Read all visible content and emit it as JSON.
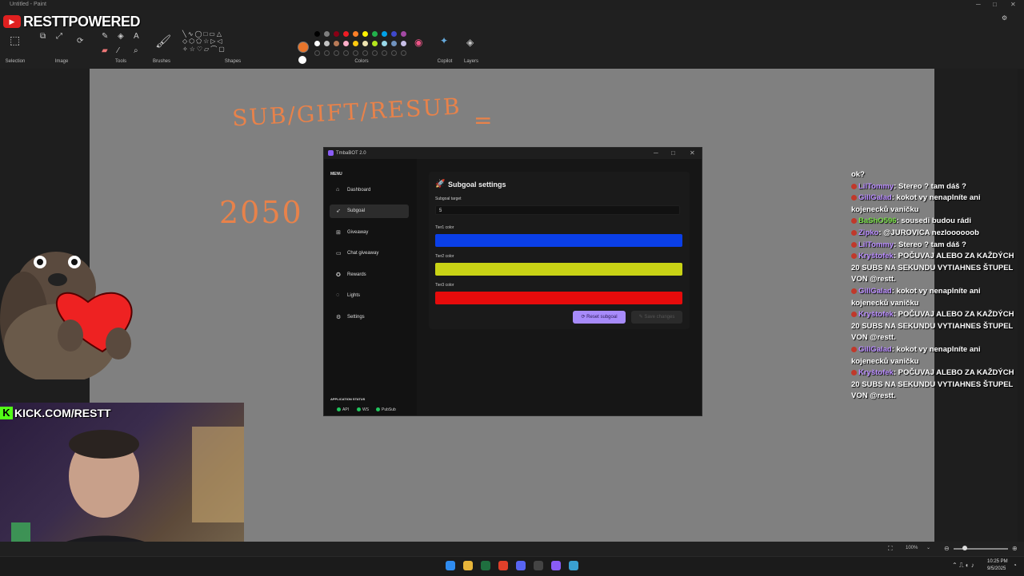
{
  "window": {
    "title": "Untitled - Paint"
  },
  "ribbon": {
    "groups": [
      "Selection",
      "Image",
      "Tools",
      "Brushes",
      "Shapes",
      "Colors",
      "Copilot",
      "Layers"
    ],
    "primary_color": "#e8752b",
    "secondary_color": "#ffffff",
    "palette": [
      "#000000",
      "#7f7f7f",
      "#880015",
      "#ed1c24",
      "#ff7f27",
      "#fff200",
      "#22b14c",
      "#00a2e8",
      "#3f48cc",
      "#a349a4",
      "#ffffff",
      "#c3c3c3",
      "#b97a57",
      "#ffaec9",
      "#ffc90e",
      "#efe4b0",
      "#b5e61d",
      "#99d9ea",
      "#7092be",
      "#c8bfe7"
    ]
  },
  "overlay": {
    "youtube_name": "RESTTPOWERED",
    "kick_url": "KICK.COM/RESTT"
  },
  "handwriting": {
    "line1": "SUB/GIFT/RESUB",
    "equals": "=",
    "number": "2050"
  },
  "app": {
    "title": "TmbaBOT 2.0",
    "menu_heading": "MENU",
    "nav": [
      {
        "label": "Dashboard",
        "icon": "home-icon"
      },
      {
        "label": "Subgoal",
        "icon": "rocket-icon"
      },
      {
        "label": "Giveaway",
        "icon": "gift-icon"
      },
      {
        "label": "Chat giveaway",
        "icon": "chat-icon"
      },
      {
        "label": "Rewards",
        "icon": "reward-icon"
      },
      {
        "label": "Lights",
        "icon": "bulb-icon"
      },
      {
        "label": "Settings",
        "icon": "gear-icon"
      }
    ],
    "active_nav": "Subgoal",
    "status_heading": "APPLICATION STATUS",
    "status": [
      {
        "label": "API",
        "color": "#22c55e"
      },
      {
        "label": "WS",
        "color": "#22c55e"
      },
      {
        "label": "PubSub",
        "color": "#22c55e"
      }
    ],
    "panel": {
      "title": "Subgoal settings",
      "target_label": "Subgoal target",
      "target_value": "5",
      "tier1_label": "Tier1 color",
      "tier1_color": "#0a3fe8",
      "tier2_label": "Tier2 color",
      "tier2_color": "#c9d315",
      "tier3_label": "Tier3 color",
      "tier3_color": "#e60b0b",
      "reset_label": "Reset subgoal",
      "save_label": "Save changes"
    }
  },
  "chat": [
    {
      "user": "",
      "text": "ok?"
    },
    {
      "user": "LilTommy",
      "user_color": "#b98cff",
      "text": "Stereo ? tam dáš ?"
    },
    {
      "user": "GillGalad",
      "user_color": "#b98cff",
      "text": "kokot vy nenaplníte ani kojenecků vaničku"
    },
    {
      "user": "BaShO596",
      "user_color": "#7be04a",
      "text": "sousedi budou rádi"
    },
    {
      "user": "Zipko",
      "user_color": "#b98cff",
      "text": "@JUROVICA nezloooooob"
    },
    {
      "user": "LilTommy",
      "user_color": "#b98cff",
      "text": "Stereo ? tam dáš ?"
    },
    {
      "user": "Kryštofek",
      "user_color": "#b98cff",
      "text": "POČUVAJ ALEBO ZA KAŽDÝCH 20 SUBS NA SEKUNDU VYTIAHNES ŠTUPEL VON @restt."
    },
    {
      "user": "GillGalad",
      "user_color": "#b98cff",
      "text": "kokot vy nenaplníte ani kojenecků vaničku"
    },
    {
      "user": "Kryštofek",
      "user_color": "#b98cff",
      "text": "POČUVAJ ALEBO ZA KAŽDÝCH 20 SUBS NA SEKUNDU VYTIAHNES ŠTUPEL VON @restt."
    },
    {
      "user": "GillGalad",
      "user_color": "#b98cff",
      "text": "kokot vy nenaplníte ani kojenecků vaničku"
    },
    {
      "user": "Kryštofek",
      "user_color": "#b98cff",
      "text": "POČUVAJ ALEBO ZA KAŽDÝCH 20 SUBS NA SEKUNDU VYTIAHNES ŠTUPEL VON @restt."
    }
  ],
  "statusbar": {
    "zoom": "100%"
  },
  "taskbar": {
    "time": "10:25 PM",
    "date": "9/5/2025"
  }
}
